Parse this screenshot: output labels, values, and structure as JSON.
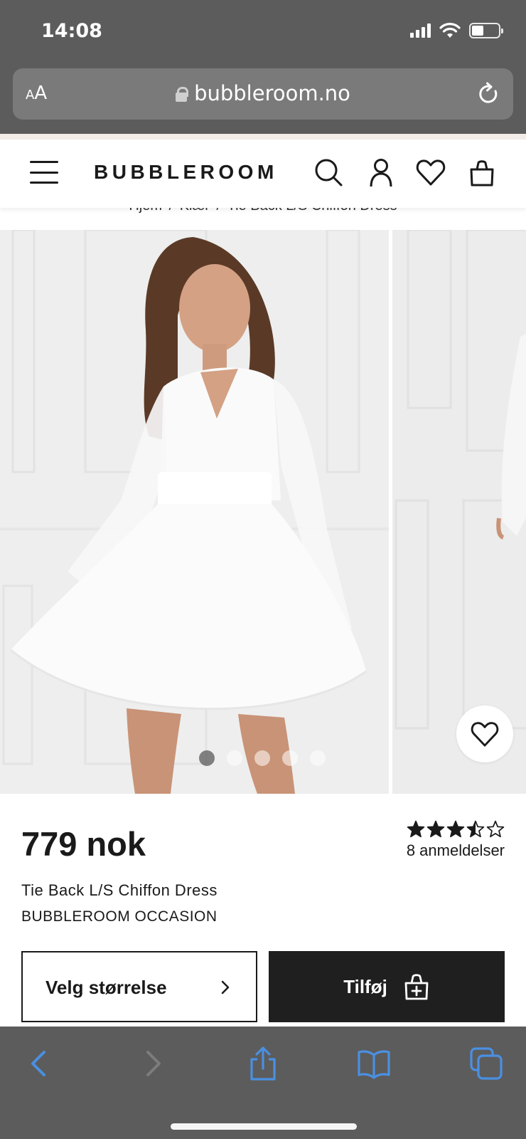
{
  "status_bar": {
    "time": "14:08",
    "battery_level": 0.45
  },
  "browser": {
    "aa_small": "A",
    "aa_big": "A",
    "url": "bubbleroom.no"
  },
  "header": {
    "logo": "BUBBLEROOM"
  },
  "breadcrumb": {
    "items": [
      "Hjem",
      "Klær",
      "Tie Back L/S Chiffon Dress"
    ],
    "separator": "/"
  },
  "gallery": {
    "image_count": 5,
    "active_index": 0
  },
  "product": {
    "price": "779 nok",
    "rating": 3.5,
    "rating_max": 5,
    "reviews_label": "8 anmeldelser",
    "name": "Tie Back L/S Chiffon Dress",
    "brand": "BUBBLEROOM OCCASION"
  },
  "actions": {
    "size_label": "Velg størrelse",
    "add_label": "Tilføj"
  },
  "colors": {
    "chrome": "#5c5c5c",
    "accent_link": "#4a90e2",
    "button_dark": "#1f1f1f",
    "text": "#1a1a1a"
  }
}
